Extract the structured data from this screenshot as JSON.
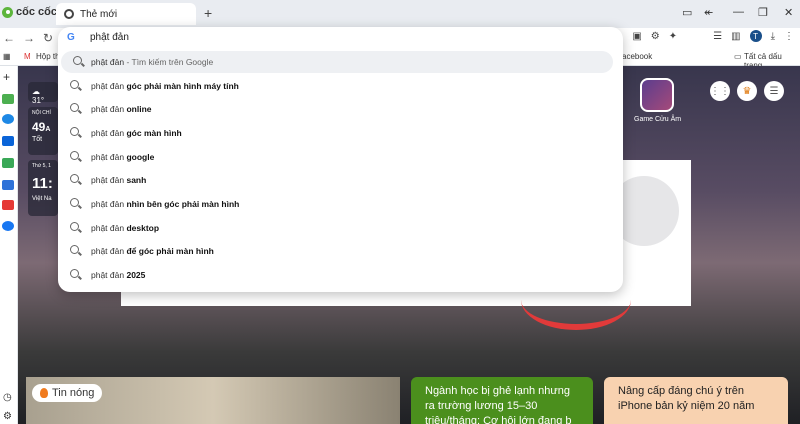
{
  "browser": {
    "logo_text": "cốc cốc",
    "tab_title": "Thẻ mới",
    "new_tab_symbol": "+",
    "bookmark_left": "Hộp th",
    "bookmark_mid": "acebook",
    "bookmark_right": "Tất cả dấu trang",
    "profile_initial": "T"
  },
  "omnibox": {
    "query": "phật đản",
    "search_hint": "- Tìm kiếm trên Google",
    "suggestions": [
      {
        "prefix": "phật đản",
        "bold": "góc phải màn hình máy tính"
      },
      {
        "prefix": "phật đản",
        "bold": "online"
      },
      {
        "prefix": "phật đản",
        "bold": "góc màn hình"
      },
      {
        "prefix": "phật đản",
        "bold": "google"
      },
      {
        "prefix": "phật đản",
        "bold": "sanh"
      },
      {
        "prefix": "phật đản",
        "bold": "nhìn bên góc phải màn hình"
      },
      {
        "prefix": "phật đản",
        "bold": "desktop"
      },
      {
        "prefix": "phật đản",
        "bold": "để góc phải màn hình"
      },
      {
        "prefix": "phật đản",
        "bold": "2025"
      }
    ]
  },
  "widgets": {
    "weather_temp": "31°",
    "location": "NỘI CHÍ",
    "aqi": "49",
    "aqi_suffix": "A",
    "aqi_label": "Tốt",
    "date": "Thứ 5, 1",
    "time": "11:",
    "lang": "Việt Na"
  },
  "game": {
    "label": "Game Cửu Âm"
  },
  "news": {
    "badge": "Tin nóng",
    "card2": "Ngành học bị ghẻ lạnh nhưng ra trường lương 15–30 triệu/tháng: Cơ hội lớn đang b",
    "card3": "Nâng cấp đáng chú ý trên iPhone bản kỷ niệm 20 năm"
  },
  "colors": {
    "accent_green": "#4b8f1d",
    "card_peach": "#f8d2b0",
    "logo_green": "#5db53c"
  }
}
